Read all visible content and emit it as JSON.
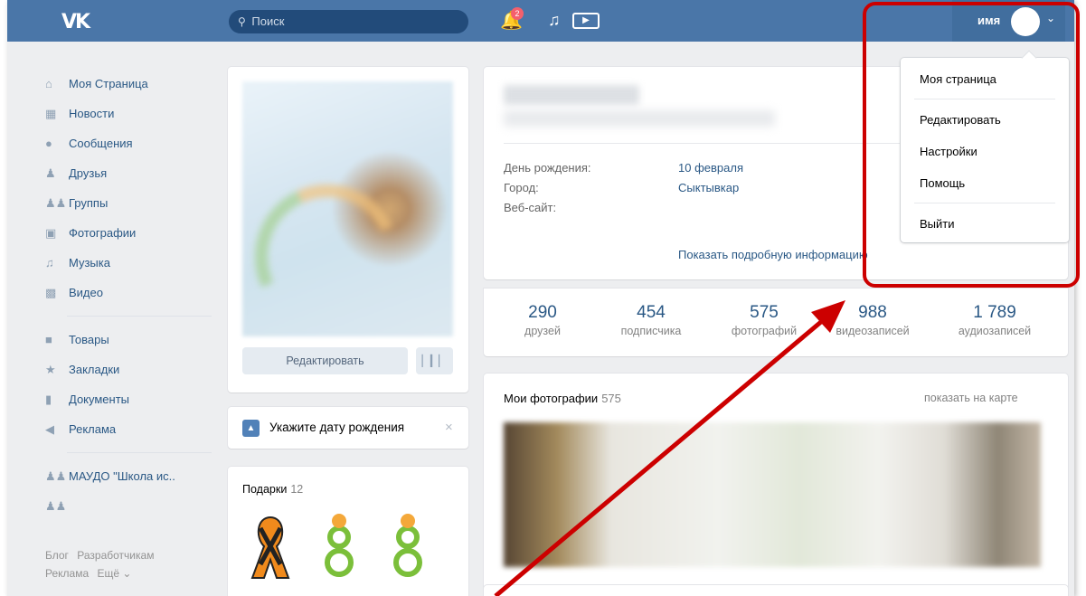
{
  "header": {
    "logo": "VK",
    "search_placeholder": "Поиск",
    "notifications_badge": "2",
    "user_name": "имя"
  },
  "sidebar": {
    "items": [
      {
        "label": "Моя Страница",
        "icon": "home-icon"
      },
      {
        "label": "Новости",
        "icon": "news-icon"
      },
      {
        "label": "Сообщения",
        "icon": "messages-icon"
      },
      {
        "label": "Друзья",
        "icon": "friends-icon"
      },
      {
        "label": "Группы",
        "icon": "groups-icon"
      },
      {
        "label": "Фотографии",
        "icon": "camera-icon"
      },
      {
        "label": "Музыка",
        "icon": "music-icon"
      },
      {
        "label": "Видео",
        "icon": "video-icon"
      }
    ],
    "items2": [
      {
        "label": "Товары",
        "icon": "bag-icon"
      },
      {
        "label": "Закладки",
        "icon": "star-icon"
      },
      {
        "label": "Документы",
        "icon": "document-icon"
      },
      {
        "label": "Реклама",
        "icon": "megaphone-icon"
      }
    ],
    "items3": [
      {
        "label": "МАУДО \"Школа ис..",
        "icon": "group-icon"
      },
      {
        "label": "",
        "icon": "group-icon"
      }
    ],
    "footer": {
      "blog": "Блог",
      "dev": "Разработчикам",
      "ads": "Реклама",
      "more": "Ещё ⌄"
    }
  },
  "profile": {
    "edit_button": "Редактировать",
    "info": [
      {
        "label": "День рождения:",
        "value": "10 февраля"
      },
      {
        "label": "Город:",
        "value": "Сыктывкар"
      },
      {
        "label": "Веб-сайт:",
        "value": ""
      }
    ],
    "show_more": "Показать подробную информацию",
    "counters": [
      {
        "num": "290",
        "label": "друзей"
      },
      {
        "num": "454",
        "label": "подписчика"
      },
      {
        "num": "575",
        "label": "фотографий"
      },
      {
        "num": "988",
        "label": "видеозаписей"
      },
      {
        "num": "1 789",
        "label": "аудиозаписей"
      }
    ]
  },
  "birthday_prompt": {
    "text": "Укажите дату рождения",
    "close": "×"
  },
  "gifts": {
    "title": "Подарки",
    "count": "12"
  },
  "photos": {
    "title": "Мои фотографии",
    "count": "575",
    "map_link": "показать на карте"
  },
  "dropdown": {
    "items": [
      "Моя страница",
      "Редактировать",
      "Настройки",
      "Помощь",
      "Выйти"
    ]
  },
  "colors": {
    "header": "#4a76a8",
    "link": "#2a5885",
    "highlight": "#cc0000"
  }
}
